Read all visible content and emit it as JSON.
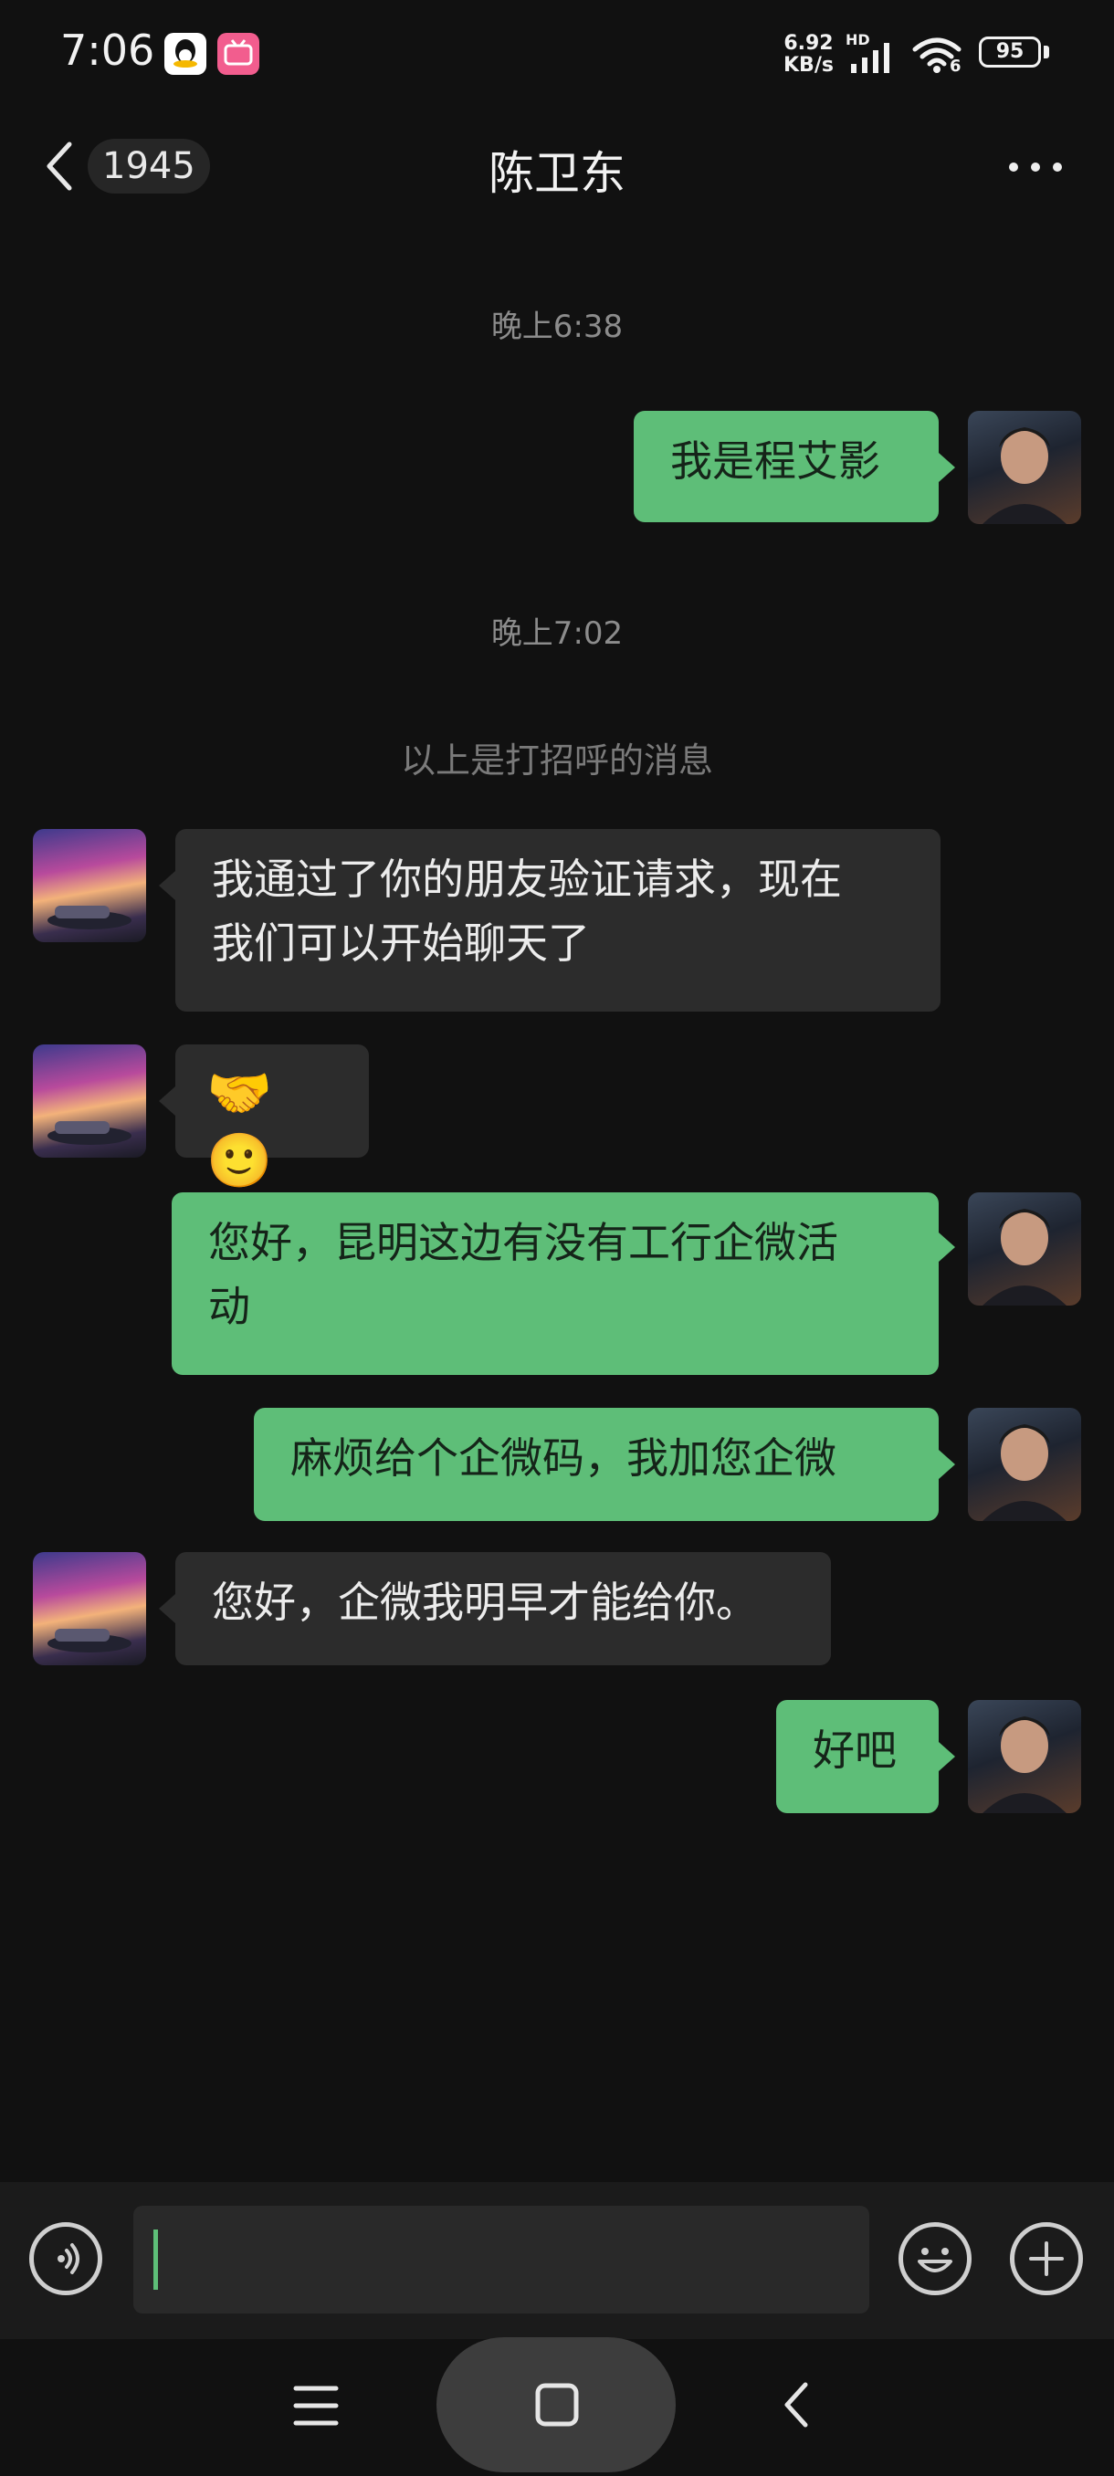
{
  "status_bar": {
    "time": "7:06",
    "net_speed_value": "6.92",
    "net_speed_unit": "KB/s",
    "hd": "HD",
    "signal_sub": "6",
    "battery": "95",
    "icons": [
      "qq-icon",
      "bilibili-icon",
      "signal-icon",
      "wifi-icon",
      "battery-icon"
    ]
  },
  "nav": {
    "unread_count": "1945",
    "title": "陈卫东",
    "icons": [
      "back-chevron-icon",
      "more-icon"
    ]
  },
  "timestamps": [
    "晚上6:38",
    "晚上7:02"
  ],
  "notice": "以上是打招呼的消息",
  "messages": [
    {
      "side": "out",
      "text": "我是程艾影"
    },
    {
      "side": "in",
      "text_line1": "我通过了你的朋友验证请求，现在",
      "text_line2": "我们可以开始聊天了"
    },
    {
      "side": "in",
      "emoji": "🤝🙂"
    },
    {
      "side": "out",
      "text_line1": "您好，昆明这边有没有工行企微活",
      "text_line2": "动"
    },
    {
      "side": "out",
      "text": "麻烦给个企微码，我加您企微"
    },
    {
      "side": "in",
      "text": "您好，企微我明早才能给你。"
    },
    {
      "side": "out",
      "text": "好吧"
    }
  ],
  "input_bar": {
    "value": "",
    "icons": [
      "voice-icon",
      "emoji-icon",
      "plus-icon"
    ]
  },
  "system_nav": {
    "icons": [
      "menu-icon",
      "home-icon",
      "back-icon"
    ]
  },
  "colors": {
    "background": "#111111",
    "outgoing_bubble": "#5ebe78",
    "incoming_bubble": "#2c2c2c",
    "cursor": "#5ebe78"
  }
}
